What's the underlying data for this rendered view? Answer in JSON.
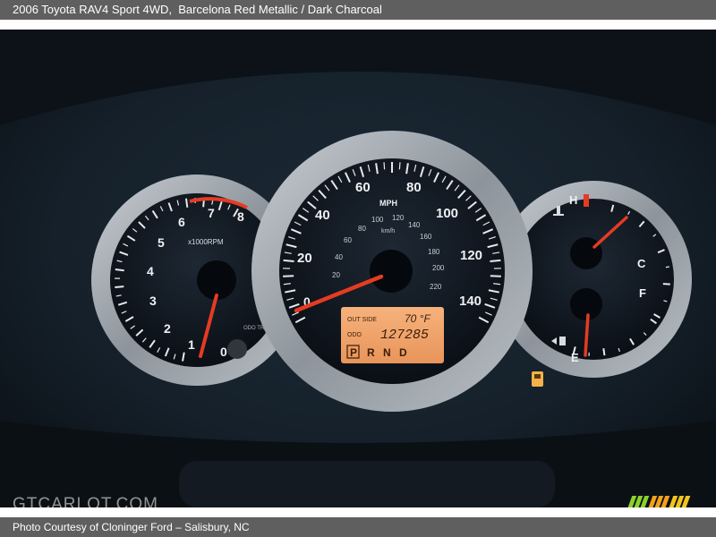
{
  "header": {
    "title": "2006 Toyota RAV4 Sport 4WD,",
    "color_info": "Barcelona Red Metallic / Dark Charcoal"
  },
  "footer": {
    "credit": "Photo Courtesy of Cloninger Ford – Salisbury, NC"
  },
  "watermark": "GTCARLOT.COM",
  "tachometer": {
    "labels": [
      "0",
      "1",
      "2",
      "3",
      "4",
      "5",
      "6",
      "7",
      "8"
    ],
    "unit": "x1000RPM",
    "odo_trip": "ODO TRIP"
  },
  "speedometer": {
    "mph_labels": [
      "20",
      "40",
      "60",
      "80",
      "100",
      "120",
      "140"
    ],
    "zero_label": "0",
    "unit_mph": "MPH",
    "kmh_labels": [
      "20",
      "40",
      "60",
      "80",
      "100",
      "120",
      "140",
      "160",
      "180",
      "200",
      "220"
    ],
    "unit_kmh": "km/h"
  },
  "lcd": {
    "outside_label": "OUT SIDE",
    "outside_temp": "70 °F",
    "odo_label": "ODO",
    "odo_value": "127285",
    "gear_active": "P",
    "gears_rest": "R N D"
  },
  "temp_gauge": {
    "hot": "H",
    "cold": "C"
  },
  "fuel_gauge": {
    "full": "F",
    "empty": "E"
  },
  "colors": {
    "needle": "#e63b22",
    "lcd_bg": "#f0a56a",
    "dial_bg": "#0e141c",
    "ring": "#a9b0b8",
    "watermark_green": "#8bd12a",
    "watermark_orange": "#f2a11c"
  }
}
